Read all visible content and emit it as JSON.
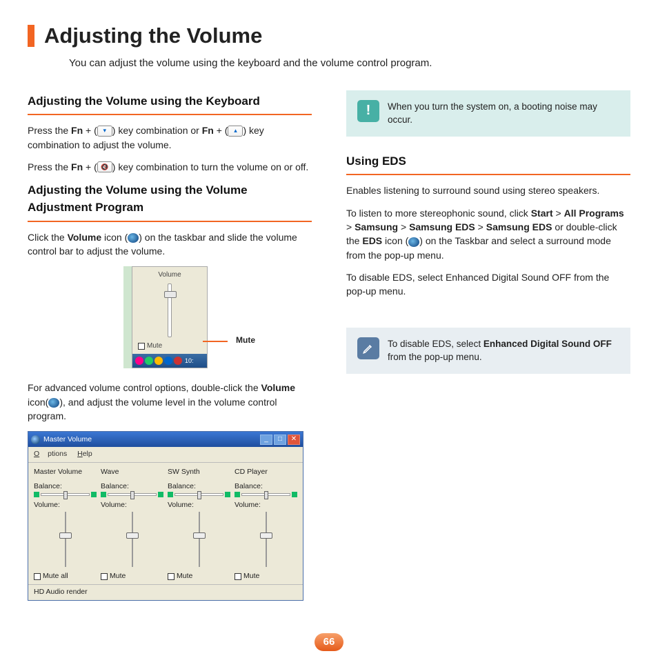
{
  "page": {
    "title": "Adjusting the Volume",
    "intro": "You can adjust the volume using the keyboard and the volume control program.",
    "number": "66"
  },
  "left": {
    "h_keyboard": "Adjusting the Volume using the Keyboard",
    "p1a": "Press the ",
    "fn": "Fn",
    "p1b": " + (",
    "p1c": ") key combination or ",
    "p1d": " + (",
    "p1e": ") key combination to adjust the volume.",
    "p2a": "Press the ",
    "p2b": " + (",
    "p2c": ") key combination to turn the volume on or off.",
    "h_program": "Adjusting the Volume using the Volume Adjustment Program",
    "p3a": "Click the ",
    "volume_b": "Volume",
    "p3b": " icon (",
    "p3c": ") on the taskbar and slide the volume control bar to adjust the volume.",
    "popup": {
      "label": "Volume",
      "mute": "Mute",
      "clock": "10:"
    },
    "mute_callout": "Mute",
    "p4a": "For advanced volume control options, double-click the ",
    "p4b": " icon(",
    "p4c": "), and adjust the volume level in the volume control program."
  },
  "master": {
    "title": "Master Volume",
    "menu_options": "Options",
    "menu_help": "Help",
    "channels": [
      {
        "name": "Master Volume",
        "bal": "Balance:",
        "vol": "Volume:",
        "mute": "Mute all"
      },
      {
        "name": "Wave",
        "bal": "Balance:",
        "vol": "Volume:",
        "mute": "Mute"
      },
      {
        "name": "SW Synth",
        "bal": "Balance:",
        "vol": "Volume:",
        "mute": "Mute"
      },
      {
        "name": "CD Player",
        "bal": "Balance:",
        "vol": "Volume:",
        "mute": "Mute"
      }
    ],
    "status": "HD Audio render"
  },
  "right": {
    "warn": "When you turn the system on, a booting noise may occur.",
    "h_eds": "Using EDS",
    "p1": "Enables listening to surround sound using stereo speakers.",
    "p2a": "To listen to more stereophonic sound, click ",
    "start": "Start",
    "gt": " > ",
    "allprog": "All Programs",
    "samsung": "Samsung",
    "seds": "Samsung EDS",
    "p2b": " or double-click the ",
    "eds_b": "EDS",
    "p2c": " icon (",
    "p2d": ") on the Taskbar and select  a surround mode from the pop-up menu.",
    "p3": "To disable EDS, select Enhanced Digital Sound OFF from the pop-up menu.",
    "note_a": "To disable EDS, select ",
    "note_b": "Enhanced Digital Sound OFF",
    "note_c": " from the pop-up menu."
  }
}
